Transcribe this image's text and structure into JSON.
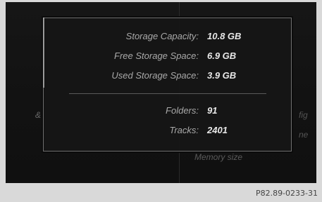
{
  "popup": {
    "rows": [
      {
        "label": "Storage Capacity:",
        "value": "10.8 GB"
      },
      {
        "label": "Free Storage Space:",
        "value": "6.9 GB"
      },
      {
        "label": "Used Storage Space:",
        "value": "3.9 GB"
      },
      {
        "label": "Folders:",
        "value": "91"
      },
      {
        "label": "Tracks:",
        "value": "2401"
      }
    ]
  },
  "background": {
    "left_marker": "&",
    "right_hint_1": "fig",
    "right_hint_2": "ne",
    "bottom_hint": "Memory size"
  },
  "caption": "P82.89-0233-31"
}
